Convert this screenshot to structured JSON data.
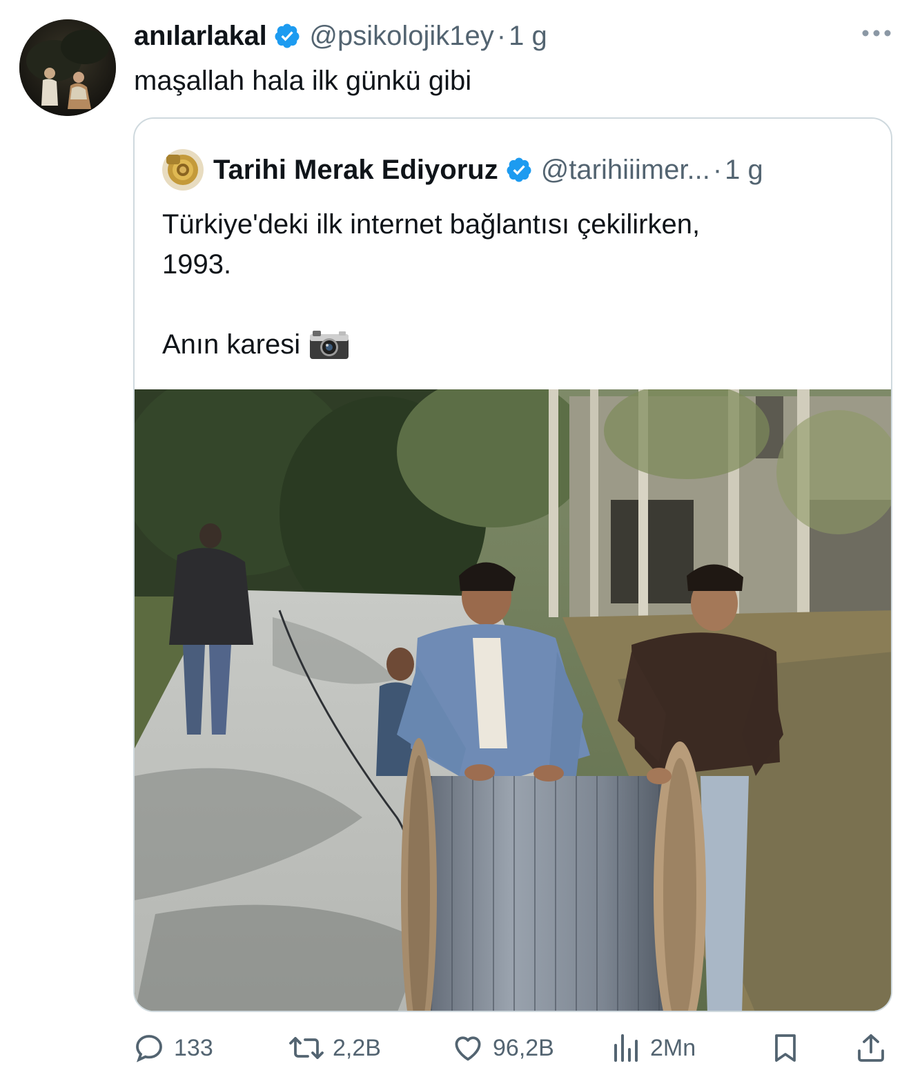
{
  "tweet": {
    "author_name": "anılarlakal",
    "author_handle": "@psikolojik1ey",
    "separator": "·",
    "time": "1 g",
    "text": "maşallah hala ilk günkü gibi"
  },
  "quoted": {
    "author_name": "Tarihi Merak Ediyoruz",
    "author_handle": "@tarihiiimer...",
    "separator": "·",
    "time": "1 g",
    "text_line1": "Türkiye'deki ilk internet bağlantısı çekilirken,",
    "text_line2": "1993.",
    "text_line3": "Anın karesi"
  },
  "actions": {
    "replies": "133",
    "reposts": "2,2B",
    "likes": "96,2B",
    "views": "2Mn"
  },
  "colors": {
    "text": "#0f1419",
    "muted": "#536471",
    "verified": "#1d9bf0",
    "border": "#cfd9de"
  },
  "icons": [
    "verified-badge-icon",
    "more-icon",
    "camera-emoji-icon",
    "reply-icon",
    "repost-icon",
    "like-icon",
    "views-icon",
    "bookmark-icon",
    "share-icon"
  ]
}
